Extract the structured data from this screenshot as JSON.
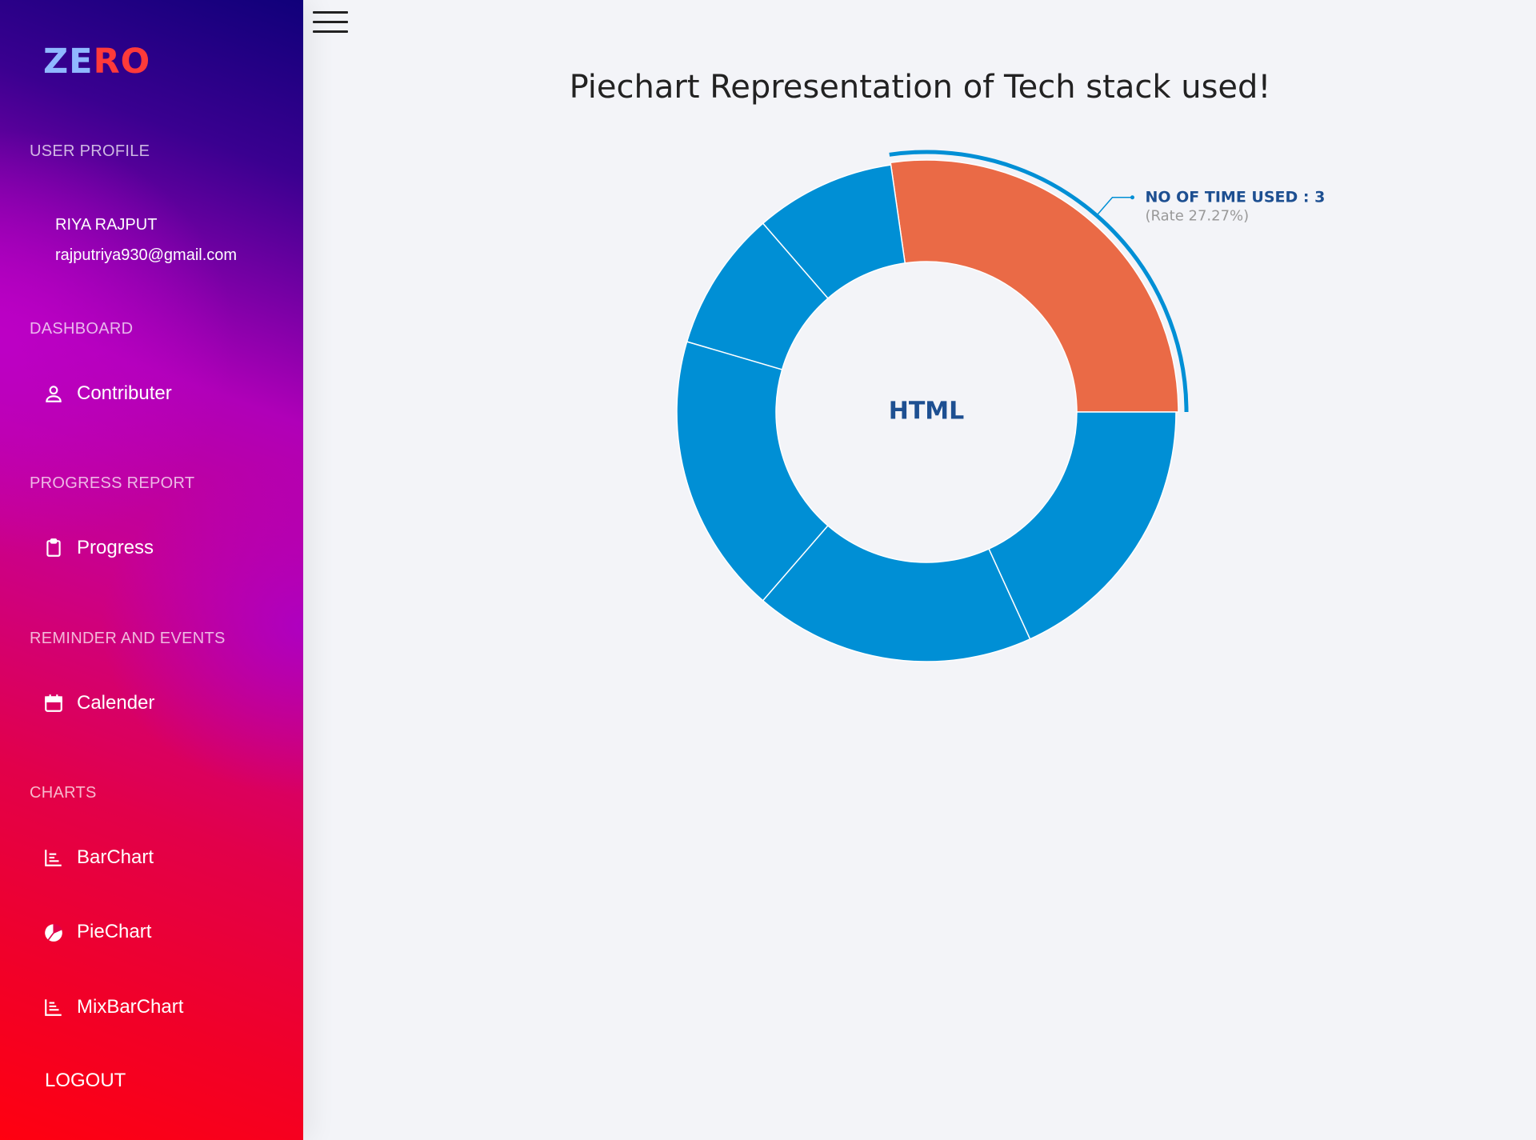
{
  "app": {
    "logo_part1": "ZE",
    "logo_part2": "RO"
  },
  "sidebar": {
    "user_profile_heading": "USER PROFILE",
    "user_name": "RIYA  RAJPUT",
    "user_email": "rajputriya930@gmail.com",
    "dashboard_heading": "DASHBOARD",
    "contributer_label": "Contributer",
    "progress_heading": "PROGRESS REPORT",
    "progress_label": "Progress",
    "reminder_heading": "REMINDER AND EVENTS",
    "calender_label": "Calender",
    "charts_heading": "CHARTS",
    "barchart_label": "BarChart",
    "piechart_label": "PieChart",
    "mixbarchart_label": "MixBarChart",
    "logout_label": "LOGOUT"
  },
  "main": {
    "title": "Piechart Representation of Tech stack used!"
  },
  "colors": {
    "slice": "#008fd5",
    "active_slice": "#ea6a46"
  },
  "chart_data": {
    "type": "pie",
    "style": "donut",
    "values": [
      3,
      1,
      1,
      2,
      2,
      2
    ],
    "active_index": 0,
    "active_name": "HTML",
    "tooltip_label": "NO OF TIME USED : 3",
    "tooltip_rate": "(Rate 27.27%)"
  }
}
